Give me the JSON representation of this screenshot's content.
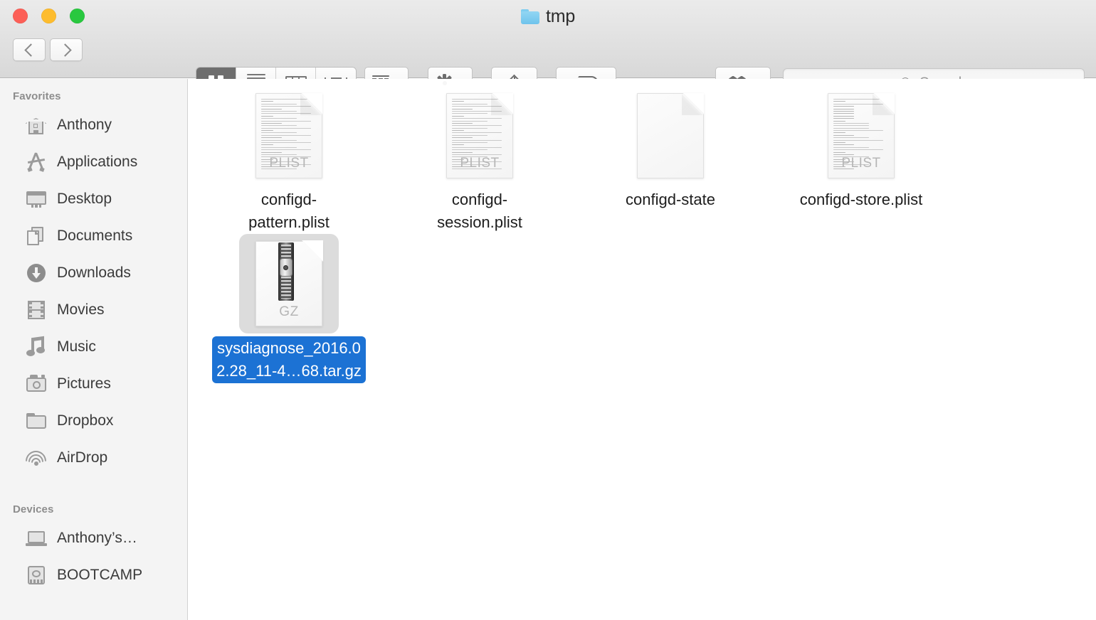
{
  "window": {
    "title": "tmp",
    "folder_icon": "folder-icon",
    "traffic_lights": [
      {
        "name": "close-button",
        "color": "#fc5f57"
      },
      {
        "name": "minimize-button",
        "color": "#fdbc2e"
      },
      {
        "name": "maximize-button",
        "color": "#29c83f"
      }
    ]
  },
  "toolbar": {
    "back_label": "",
    "forward_label": "",
    "view_modes": [
      {
        "id": "icon",
        "icon": "grid-icon",
        "active": true
      },
      {
        "id": "list",
        "icon": "list-icon",
        "active": false
      },
      {
        "id": "column",
        "icon": "columns-icon",
        "active": false
      },
      {
        "id": "cover",
        "icon": "coverflow-icon",
        "active": false
      }
    ],
    "arrange": {
      "icon": "arrange-grid-icon",
      "chevron": "chevron-down-icon"
    },
    "action": {
      "icon": "gear-icon",
      "chevron": "chevron-down-icon"
    },
    "share": {
      "icon": "share-icon"
    },
    "tags": {
      "icon": "tag-icon"
    },
    "dropbox": {
      "icon": "dropbox-icon",
      "chevron": "chevron-down-icon"
    }
  },
  "search": {
    "placeholder": "Search",
    "icon": "search-icon",
    "value": ""
  },
  "sidebar": {
    "sections": [
      {
        "title": "Favorites",
        "items": [
          {
            "label": "Anthony",
            "icon": "home-icon"
          },
          {
            "label": "Applications",
            "icon": "applications-icon"
          },
          {
            "label": "Desktop",
            "icon": "desktop-icon"
          },
          {
            "label": "Documents",
            "icon": "documents-icon"
          },
          {
            "label": "Downloads",
            "icon": "downloads-icon"
          },
          {
            "label": "Movies",
            "icon": "movies-icon"
          },
          {
            "label": "Music",
            "icon": "music-icon"
          },
          {
            "label": "Pictures",
            "icon": "pictures-icon"
          },
          {
            "label": "Dropbox",
            "icon": "folder-icon"
          },
          {
            "label": "AirDrop",
            "icon": "airdrop-icon"
          }
        ]
      },
      {
        "title": "Devices",
        "items": [
          {
            "label": "Anthony’s…",
            "icon": "laptop-icon"
          },
          {
            "label": "BOOTCAMP",
            "icon": "harddisk-icon"
          }
        ]
      }
    ]
  },
  "files": [
    {
      "name": "configd-pattern.plist",
      "line1": "configd-",
      "line2": "pattern.plist",
      "kind": "plist",
      "ext_label": "PLIST",
      "selected": false
    },
    {
      "name": "configd-session.plist",
      "line1": "configd-",
      "line2": "session.plist",
      "kind": "plist",
      "ext_label": "PLIST",
      "selected": false
    },
    {
      "name": "configd-state",
      "line1": "configd-state",
      "line2": "",
      "kind": "blank",
      "ext_label": "",
      "selected": false
    },
    {
      "name": "configd-store.plist",
      "line1": "configd-store.plist",
      "line2": "",
      "kind": "plist",
      "ext_label": "PLIST",
      "selected": false
    },
    {
      "name": "sysdiagnose_2016.02.28_11-4…68.tar.gz",
      "line1": "sysdiagnose_2016.0",
      "line2": "2.28_11-4…68.tar.gz",
      "kind": "gz",
      "ext_label": "GZ",
      "selected": true
    }
  ],
  "colors": {
    "selection_blue": "#1c72d4",
    "selection_icon_bg": "#dcdcdc",
    "sidebar_bg": "#f4f4f4",
    "toolbar_bg": "#dedede",
    "folder_blue": "#6ec3ec"
  }
}
